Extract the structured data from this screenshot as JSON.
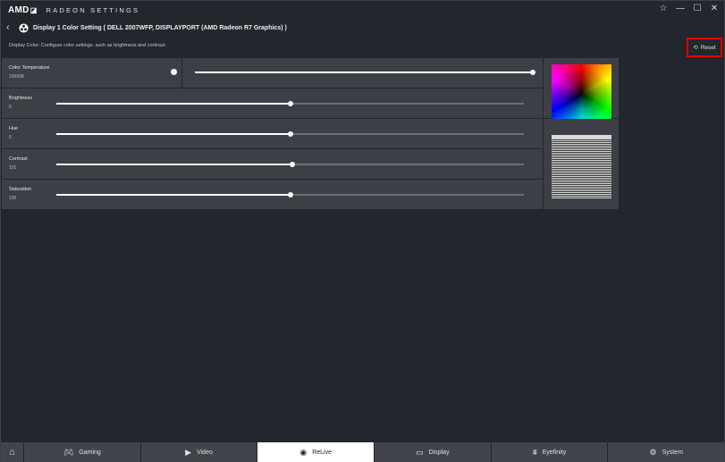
{
  "titlebar": {
    "brand": "AMD",
    "brand_arrow": "◪",
    "app_title": "RADEON SETTINGS",
    "controls": {
      "star": "☆",
      "minimize": "—",
      "maximize": "☐",
      "close": "✕"
    }
  },
  "header": {
    "back_glyph": "‹",
    "title": "Display 1 Color Setting ( DELL 2007WFP, DISPLAYPORT (AMD Radeon R7 Graphics) )"
  },
  "description": "Display Color: Configure color settings, such as brightness and contrast.",
  "reset": {
    "label": "Reset",
    "icon": "⟲"
  },
  "color_temperature": {
    "label": "Color Temperature",
    "value": "10000K",
    "toggle_on": true,
    "slider_fraction": 1.0
  },
  "settings": [
    {
      "label": "Brightness",
      "value": "0",
      "fraction": 0.5
    },
    {
      "label": "Hue",
      "value": "0",
      "fraction": 0.5
    },
    {
      "label": "Contrast",
      "value": "101",
      "fraction": 0.505
    },
    {
      "label": "Saturation",
      "value": "100",
      "fraction": 0.5
    }
  ],
  "nav": {
    "home_icon": "⌂",
    "tabs": [
      {
        "label": "Gaming",
        "icon": "🎮︎",
        "icon_name": "gamepad-icon",
        "active": false
      },
      {
        "label": "Video",
        "icon": "▶",
        "icon_name": "play-icon",
        "active": false
      },
      {
        "label": "ReLive",
        "icon": "◉",
        "icon_name": "relive-icon",
        "active": true
      },
      {
        "label": "Display",
        "icon": "▭",
        "icon_name": "monitor-icon",
        "active": false
      },
      {
        "label": "Eyefinity",
        "icon": "⩩",
        "icon_name": "eyefinity-icon",
        "active": false
      },
      {
        "label": "System",
        "icon": "⚙",
        "icon_name": "system-gear-icon",
        "active": false
      }
    ]
  },
  "colors": {
    "background": "#22262d",
    "panel": "#3c3f45",
    "highlight_border": "#e00000",
    "slider_fill": "#ffffff",
    "slider_track": "#6b6e74"
  }
}
